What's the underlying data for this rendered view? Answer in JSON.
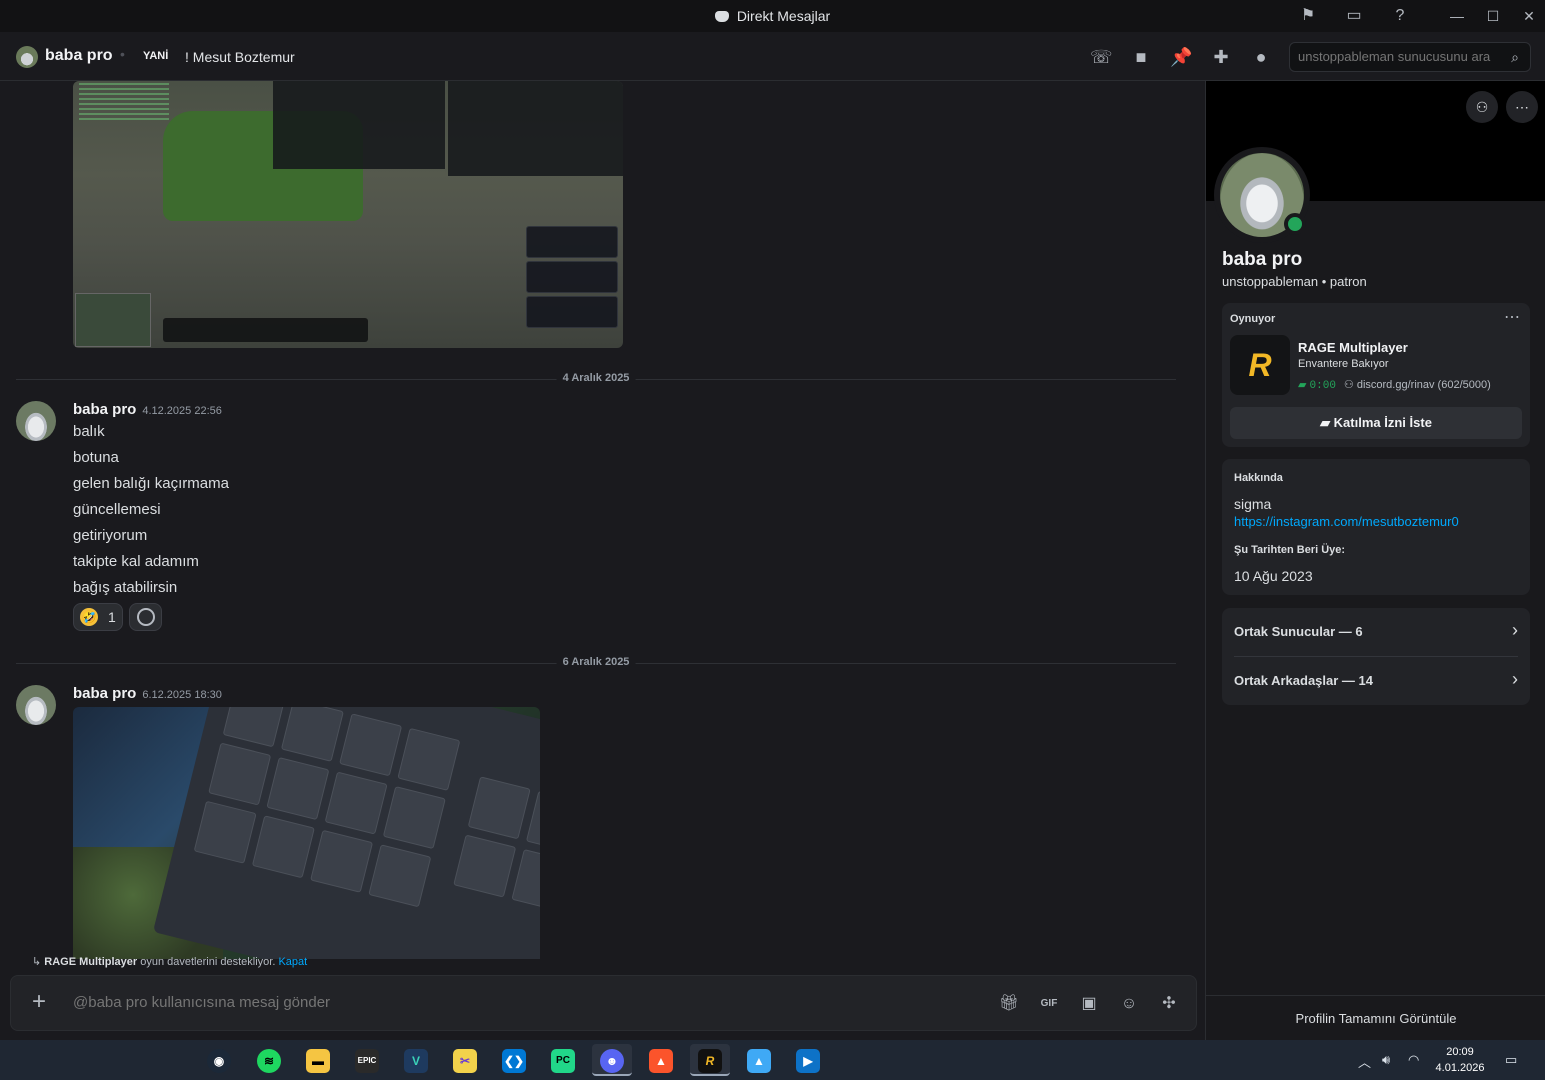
{
  "window": {
    "title": "Direkt Mesajlar"
  },
  "header": {
    "name": "baba pro",
    "tag": "YANİ",
    "custom_status": "! Mesut Boztemur",
    "search_placeholder": "unstoppableman sunucusunu ara"
  },
  "chat": {
    "dividers": [
      "4 Aralık 2025",
      "6 Aralık 2025"
    ],
    "messages": [
      {
        "author": "baba pro",
        "time": "4.12.2025 22:56",
        "lines": [
          "balık",
          "botuna",
          "gelen balığı kaçırmama",
          "güncellemesi",
          "getiriyorum",
          "takipte kal adamım",
          "bağış atabilirsin"
        ],
        "reactions": [
          {
            "emoji": "🤣",
            "count": "1"
          }
        ]
      },
      {
        "author": "baba pro",
        "time": "6.12.2025 18:30",
        "lines": []
      }
    ]
  },
  "invite_bar": {
    "game": "RAGE Multiplayer",
    "text": " oyun davetlerini destekliyor. ",
    "dismiss": "Kapat"
  },
  "composer": {
    "placeholder": "@baba pro kullanıcısına mesaj gönder"
  },
  "profile": {
    "name": "baba pro",
    "username_line": "unstoppableman • patron",
    "activity": {
      "label": "Oynuyor",
      "game": "RAGE Multiplayer",
      "state": "Envantere Bakıyor",
      "elapsed": "0:00",
      "party": "discord.gg/rinav (602/5000)",
      "join_label": "Katılma İzni İste",
      "icon_letter": "R"
    },
    "about": {
      "label": "Hakkında",
      "bio": "sigma",
      "link": "https://instagram.com/mesutboztemur0",
      "member_since_label": "Şu Tarihten Beri Üye:",
      "member_since": "10 Ağu 2023"
    },
    "mutual": {
      "servers": "Ortak Sunucular — 6",
      "friends": "Ortak Arkadaşlar — 14"
    },
    "full_profile": "Profilin Tamamını Görüntüle"
  },
  "taskbar": {
    "time": "20:09",
    "date": "4.01.2026"
  },
  "colors": {
    "accent": "#5865f2",
    "online": "#23a55a",
    "link": "#00a8fc",
    "game_brand": "#f2b826"
  }
}
